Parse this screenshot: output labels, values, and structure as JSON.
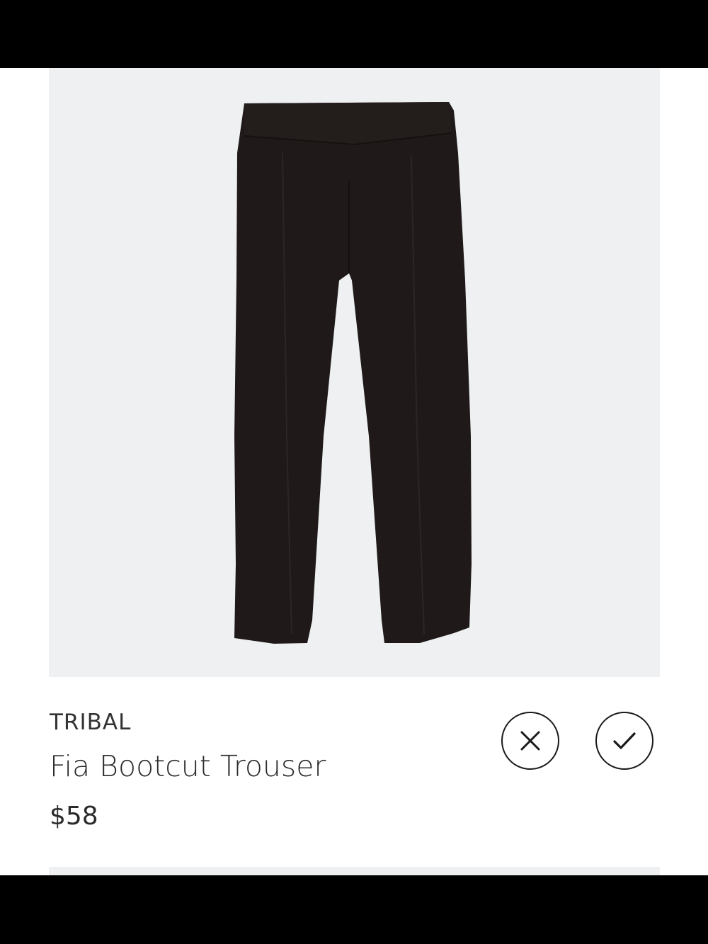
{
  "product": {
    "brand": "TRIBAL",
    "name": "Fia Bootcut Trouser",
    "price": "$58",
    "image_icon": "black-trousers-image",
    "image_background": "#eef0f2",
    "garment_color": "#1f1a19"
  },
  "actions": {
    "reject_icon": "close-icon",
    "keep_icon": "checkmark-icon"
  }
}
